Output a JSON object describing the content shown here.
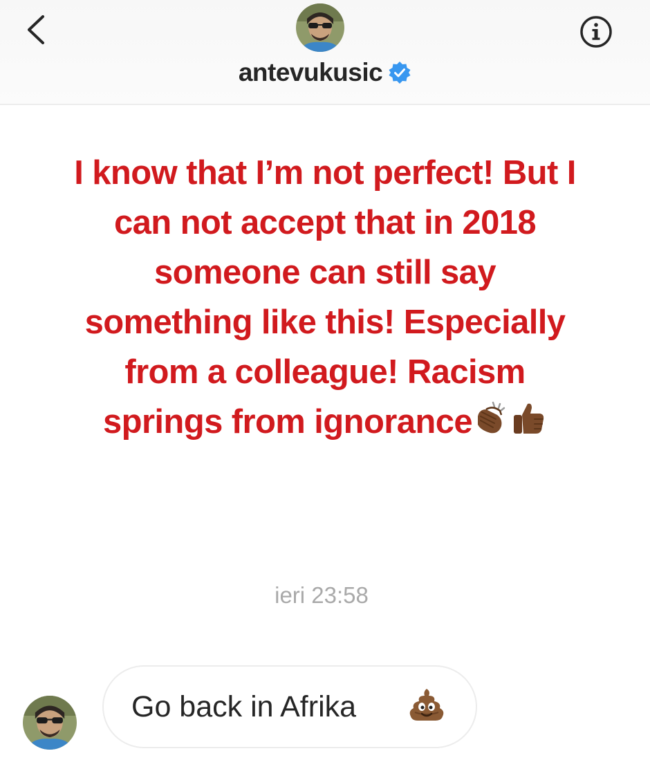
{
  "header": {
    "username": "antevukusic",
    "verified": true,
    "back_icon": "chevron-left-icon",
    "info_icon": "info-icon",
    "avatar_icon": "profile-avatar"
  },
  "story": {
    "text": "I know that I’m not perfect! But I can not accept that in 2018 someone can still say something like this! Especially from a colleague! Racism springs from ignorance",
    "emojis": [
      "clapping-hands-icon",
      "thumbs-up-icon"
    ],
    "color": "#d11a1e"
  },
  "story_timestamp": "ieri 23:58",
  "message": {
    "text": "Go back in Afrika",
    "emoji": "pile-of-poo-icon"
  },
  "colors": {
    "accent_verified": "#3897f0",
    "text_primary": "#262626",
    "timestamp": "#a9a9a9"
  }
}
